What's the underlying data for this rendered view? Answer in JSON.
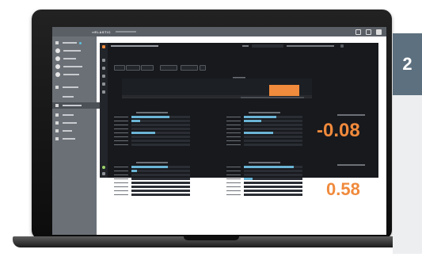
{
  "badge": {
    "number": "2"
  },
  "colors": {
    "accent_orange": "#f08a3c",
    "bar_blue": "#6bb5d6",
    "panel_bg": "#17191d"
  },
  "app": {
    "logo_text": "∞ELASTIC",
    "window_icons": [
      "window-icon",
      "user-icon",
      "close-icon"
    ]
  },
  "metrics": {
    "top_right_value": "-0.08",
    "bottom_right_value": "0.58"
  },
  "chart_data": [
    {
      "type": "bar",
      "title": "",
      "orientation": "horizontal",
      "values": [
        0.65,
        0.15,
        0,
        0,
        0.4,
        0,
        0,
        0
      ]
    },
    {
      "type": "bar",
      "title": "",
      "orientation": "horizontal",
      "values": [
        0.55,
        0.3,
        0,
        0,
        0.5,
        0,
        0,
        0
      ]
    },
    {
      "type": "bar",
      "title": "",
      "orientation": "horizontal",
      "values": [
        0.62,
        0.1,
        0,
        0,
        0,
        0,
        0,
        0
      ]
    },
    {
      "type": "bar",
      "title": "",
      "orientation": "horizontal",
      "values": [
        0.85,
        0,
        0,
        0.15,
        0,
        0,
        0,
        0
      ]
    },
    {
      "type": "bar",
      "title": "",
      "orientation": "horizontal",
      "values": [
        0,
        0,
        0,
        0,
        0,
        0,
        0,
        0,
        0,
        0,
        0,
        1
      ]
    }
  ]
}
